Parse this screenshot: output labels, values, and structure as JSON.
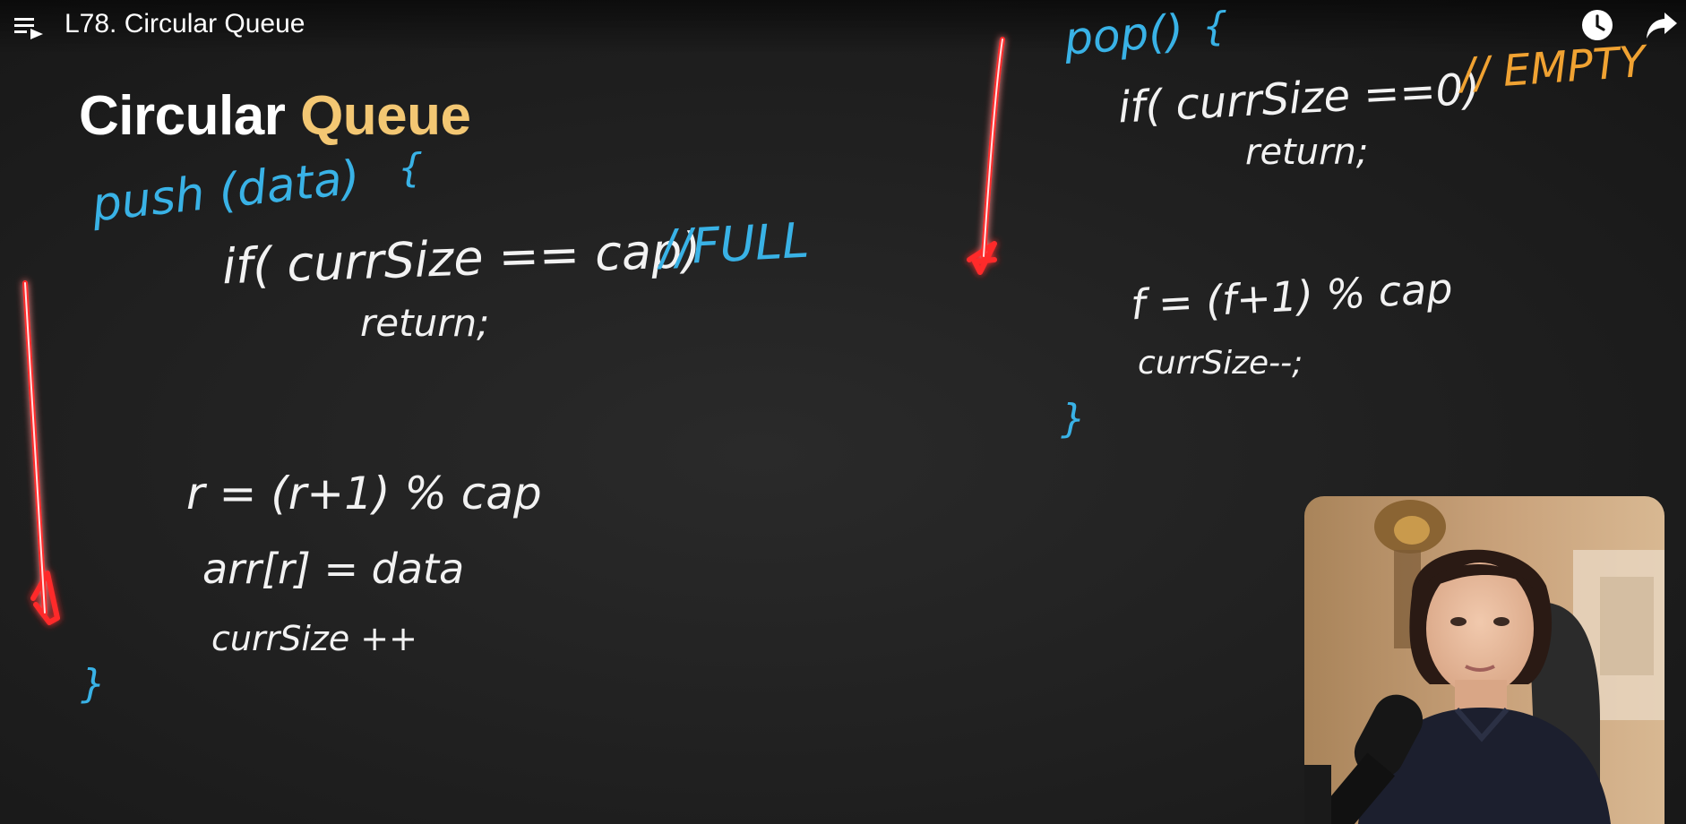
{
  "header": {
    "title": "L78. Circular Queue"
  },
  "icons": {
    "playlist": "playlist-icon",
    "watch_later": "clock-icon",
    "share": "share-icon"
  },
  "heading": {
    "word1": "Circular",
    "word2": "Queue"
  },
  "push_code": {
    "signature": "push (data)",
    "open_brace": "{",
    "condition": "if( currSize == cap)",
    "comment": "//FULL",
    "return_stmt": "return;",
    "rear_update": "r = (r+1) % cap",
    "assign": "arr[r] = data",
    "increment": "currSize ++",
    "close_brace": "}"
  },
  "pop_code": {
    "signature": "pop()",
    "open_brace": "{",
    "condition": "if( currSize ==0)",
    "comment": "// EMPTY",
    "return_stmt": "return;",
    "front_update": "f = (f+1) % cap",
    "decrement": "currSize--;",
    "close_brace": "}"
  },
  "colors": {
    "chalk": "#f2f2f2",
    "blue_ink": "#39b2e6",
    "orange_ink": "#f0a232",
    "arrow_red": "#ff2b2b",
    "heading_accent": "#f3c773"
  }
}
